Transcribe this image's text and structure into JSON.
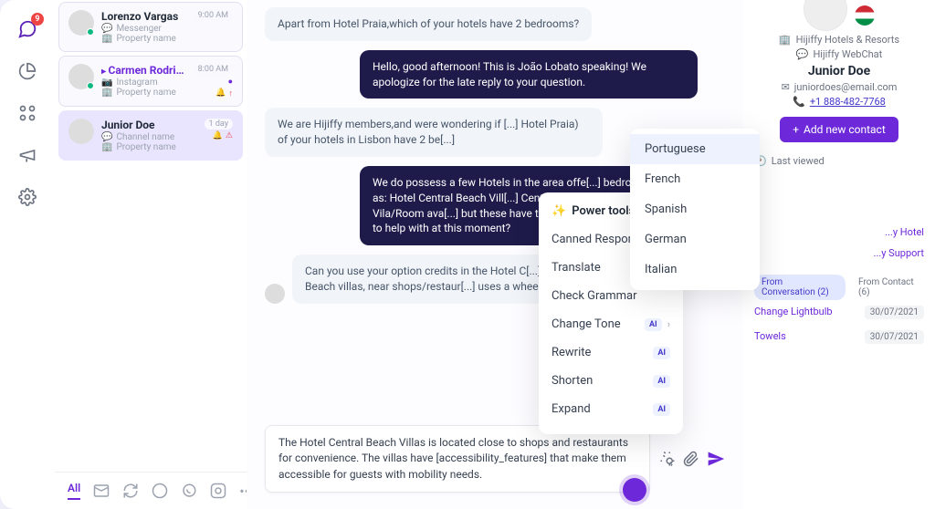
{
  "nav": {
    "inbox_badge": "9"
  },
  "conversations": [
    {
      "name": "Lorenzo Vargas",
      "channel": "Messenger",
      "property": "Property name",
      "time": "9:00 AM"
    },
    {
      "name": "Carmen Rodrigues",
      "channel": "Instagram",
      "property": "Property name",
      "time": "8:00 AM"
    },
    {
      "name": "Junior Doe",
      "channel": "Channel name",
      "property": "Property name",
      "time": "1 day"
    }
  ],
  "filters": {
    "all": "All"
  },
  "messages": {
    "m1": "Apart from Hotel Praia,which of your hotels have 2 bedrooms?",
    "m2": "Hello, good afternoon! This is João Lobato speaking! We apologize for the late reply to your question.",
    "m3": "We are Hijiffy members,and were wondering if [...] Hotel Praia) of your hotels in Lisbon have 2 be[...]",
    "m4": "We do possess a few Hotels in the area offe[...] bedrooms. Such as: Hotel Central Beach Vill[...] Central Palm Gardens. Actual Vila/Room ava[...] but these have the possibility. Is there anyt[...] to help with at this moment?",
    "m5": "Can you use your option credits in the Hotel C[...] are the Alvor Beach villas, near shops/restaur[...] uses a wheelchair?"
  },
  "composer": "The Hotel Central Beach Villas is located close to shops and restaurants for convenience. The villas have [accessibility_features] that make them accessible for guests with mobility needs.",
  "power_tools": {
    "title": "Power tools",
    "items": {
      "canned": "Canned Responses",
      "translate": "Translate",
      "grammar": "Check Grammar",
      "tone": "Change Tone",
      "rewrite": "Rewrite",
      "shorten": "Shorten",
      "expand": "Expand"
    },
    "ai": "AI"
  },
  "translate_menu": [
    "Portuguese",
    "French",
    "Spanish",
    "German",
    "Italian"
  ],
  "contact": {
    "org": "Hijiffy Hotels & Resorts",
    "channel": "Hijiffy WebChat",
    "name": "Junior Doe",
    "email": "juniordoes@email.com",
    "phone": "+1 888-482-7768",
    "add": "Add new contact",
    "last_viewed": "Last viewed",
    "links": [
      {
        "t": "...y Hotel",
        "l": ""
      },
      {
        "t": "...y Support",
        "l": ""
      }
    ],
    "pill_conv": "From Conversation",
    "pill_conv_n": "(2)",
    "pill_contact": "From Contact",
    "pill_contact_n": "(6)",
    "items": [
      {
        "n": "Change Lightbulb",
        "d": "30/07/2021"
      },
      {
        "n": "Towels",
        "d": "30/07/2021"
      }
    ]
  }
}
